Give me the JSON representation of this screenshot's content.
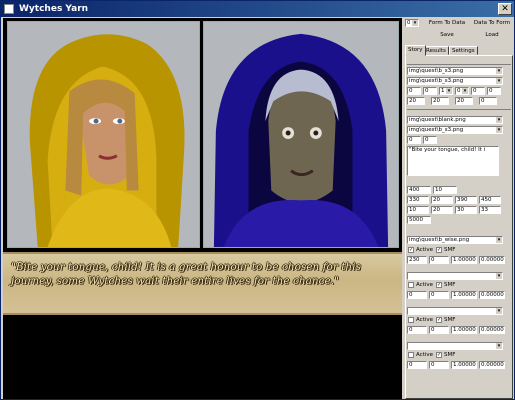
{
  "window": {
    "title": "Wytches Yarn",
    "close": "✕"
  },
  "dialogue": "\"Bite your tongue, child! It is a great honour to be chosen for this journey, some Wytches wait their entire lives for the chance.\"",
  "editor": {
    "frame_value": "0",
    "form_to_data": "Form To Data",
    "data_to_form": "Data To Form",
    "save": "Save",
    "load": "Load",
    "tabs": [
      "Story",
      "Results",
      "Settings"
    ],
    "image_left": "img\\quest\\b_s3.png",
    "image_right": "img\\quest\\b_s3.png",
    "row_a": [
      "0",
      "0",
      "1",
      "0",
      "0",
      "0"
    ],
    "row_b": [
      "20",
      "20",
      "20",
      "0"
    ],
    "bg_image": "img\\quest\\blank.png",
    "bg_image2": "img\\quest\\b_s3.png",
    "row_c": [
      "0",
      "0"
    ],
    "story_text": "\"Bite your tongue, child! It i",
    "row_d": [
      "400",
      "10"
    ],
    "row_e": [
      "330",
      "20",
      "390",
      "450"
    ],
    "row_f": [
      "10",
      "20",
      "30",
      "33"
    ],
    "row_g": "5000",
    "sound_file": "img\\quest\\b_wise.png",
    "active_label": "Active",
    "smf_label": "SMF",
    "sound_row1": [
      "230",
      "0",
      "1.00000",
      "0.00000"
    ],
    "sound_row2": [
      "0",
      "0",
      "1.00000",
      "0.00000"
    ],
    "sound_row3": [
      "0",
      "0",
      "1.00000",
      "0.00000"
    ],
    "sound_row4": [
      "0",
      "0",
      "1.00000",
      "0.00000"
    ]
  }
}
